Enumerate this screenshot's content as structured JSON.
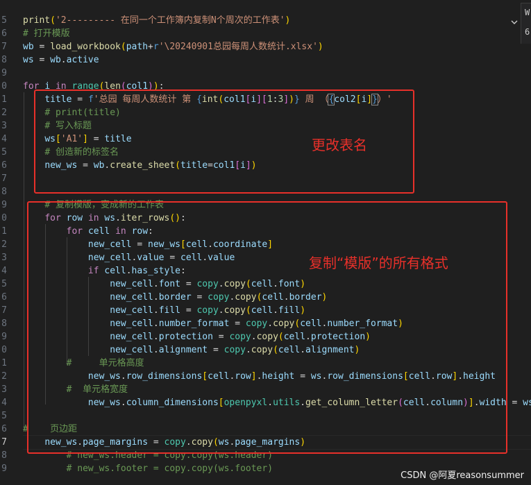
{
  "gutter_numbers": [
    "5",
    "6",
    "7",
    "8",
    "9",
    "0",
    "1",
    "2",
    "3",
    "4",
    "5",
    "6",
    "7",
    "8",
    "9",
    "0",
    "1",
    "2",
    "3",
    "4",
    "5",
    "6",
    "7",
    "8",
    "9",
    "0",
    "1",
    "2",
    "3",
    "4",
    "5",
    "6",
    "7",
    "8",
    "9"
  ],
  "annotations": {
    "rename_label": "更改表名",
    "copy_format_label": "复制“模版”的所有格式"
  },
  "right_panel": {
    "letter": "W",
    "number": "6"
  },
  "watermark": "CSDN @阿夏reasonsummer",
  "code": {
    "l1_print": "print",
    "l1_str": "'2--------- 在同一个工作簿内复制N个周次的工作表'",
    "l2_comment": "# 打开模版",
    "l3_a": "wb",
    "l3_fn": "load_workbook",
    "l3_arg": "path",
    "l3_prefix": "r",
    "l3_str": "'\\20240901总园每周人数统计.xlsx'",
    "l4_a": "ws",
    "l4_b": "wb",
    "l4_c": "active",
    "l6_for": "for",
    "l6_i": "i",
    "l6_in": "in",
    "l6_range": "range",
    "l6_len": "len",
    "l6_col1": "col1",
    "l7_title": "title",
    "l7_f": "f",
    "l7_str1": "'总园 每周人数统计 第 ",
    "l7_int": "int",
    "l7_col1": "col1",
    "l7_i": "i",
    "l7_n1": "1",
    "l7_n3": "3",
    "l7_str2": " 周 （",
    "l7_col2": "col2",
    "l7_i2": "i",
    "l7_str3": "）'",
    "l8_comment": "# print(title)",
    "l9_comment": "# 写入标题",
    "l10_ws": "ws",
    "l10_key": "'A1'",
    "l10_title": "title",
    "l11_comment": "# 创造新的标签名",
    "l12_new_ws": "new_ws",
    "l12_wb": "wb",
    "l12_fn": "create_sheet",
    "l12_kw": "title",
    "l12_col1": "col1",
    "l12_i": "i",
    "l15_comment": "# 复制模版，变成新的工作表",
    "l16_for": "for",
    "l16_row": "row",
    "l16_in": "in",
    "l16_ws": "ws",
    "l16_fn": "iter_rows",
    "l17_for": "for",
    "l17_cell": "cell",
    "l17_in": "in",
    "l17_row": "row",
    "l18_a": "new_cell",
    "l18_b": "new_ws",
    "l18_c": "cell",
    "l18_d": "coordinate",
    "l19_a": "new_cell",
    "l19_b": "value",
    "l19_c": "cell",
    "l19_d": "value",
    "l20_if": "if",
    "l20_cell": "cell",
    "l20_attr": "has_style",
    "attrs": [
      "font",
      "border",
      "fill",
      "number_format",
      "protection",
      "alignment"
    ],
    "copy_mod": "copy",
    "copy_fn": "copy",
    "new_cell": "new_cell",
    "cell": "cell",
    "l27_comment": "#     单元格高度",
    "l28_new_ws": "new_ws",
    "l28_rd": "row_dimensions",
    "l28_cell": "cell",
    "l28_row": "row",
    "l28_height": "height",
    "l28_ws": "ws",
    "l29_comment": "#  单元格宽度",
    "l30_new_ws": "new_ws",
    "l30_cd": "column_dimensions",
    "l30_mod": "openpyxl",
    "l30_utils": "utils",
    "l30_fn": "get_column_letter",
    "l30_cell": "cell",
    "l30_col": "column",
    "l30_width": "width",
    "l30_ws": "ws",
    "l32_comment": "#    页边距",
    "l33_new_ws": "new_ws",
    "l33_pm": "page_margins",
    "l33_copy": "copy",
    "l33_ws": "ws",
    "l34_comment": "# new_ws.header = copy.copy(ws.header)",
    "l35_comment": "# new_ws.footer = copy.copy(ws.footer)"
  }
}
